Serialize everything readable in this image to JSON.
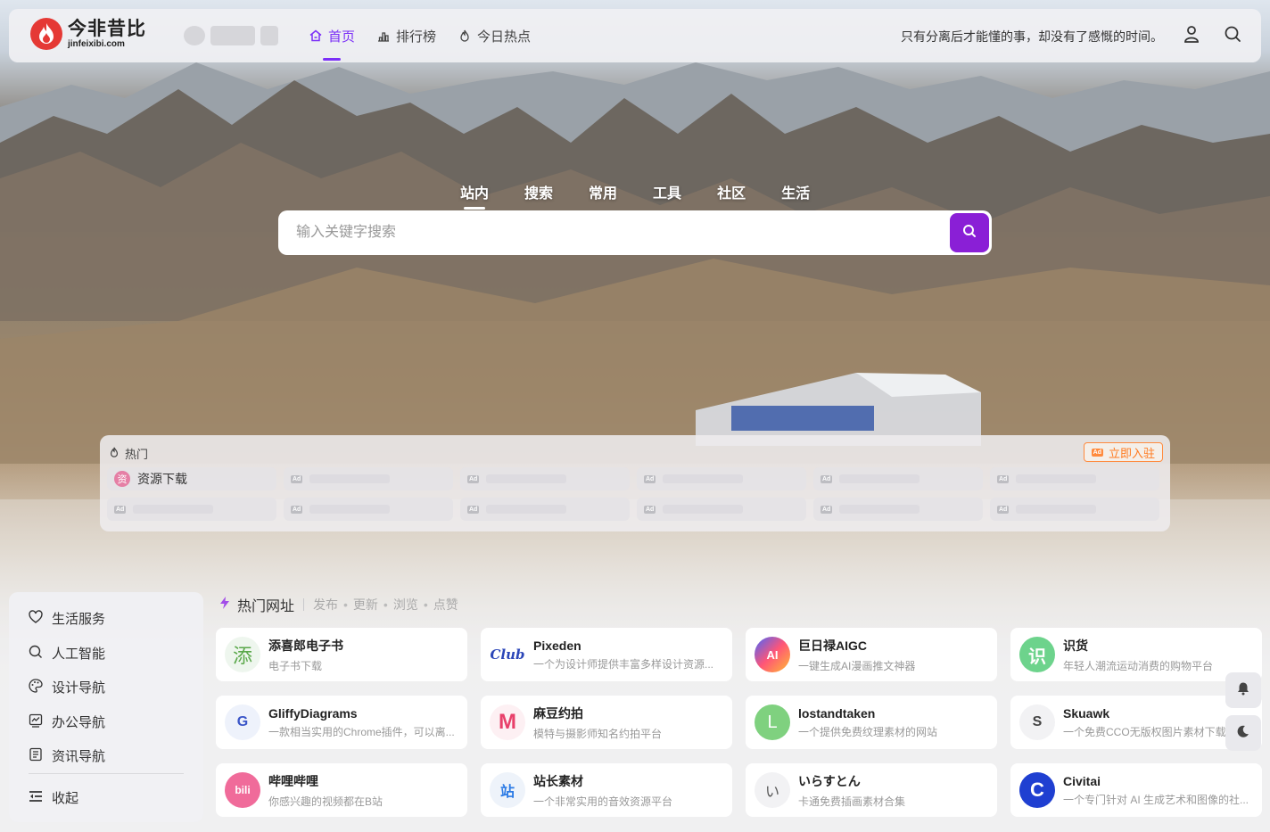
{
  "site": {
    "logo_cn": "今非昔比",
    "logo_en": "jinfeixibi.com",
    "slogan": "只有分离后才能懂的事，却没有了感慨的时间。"
  },
  "nav": {
    "items": [
      {
        "label": "首页",
        "icon": "home-icon",
        "active": true
      },
      {
        "label": "排行榜",
        "icon": "ranking-icon",
        "active": false
      },
      {
        "label": "今日热点",
        "icon": "fire-icon",
        "active": false
      }
    ]
  },
  "search": {
    "tabs": [
      "站内",
      "搜索",
      "常用",
      "工具",
      "社区",
      "生活"
    ],
    "active_tab": "站内",
    "placeholder": "输入关键字搜索"
  },
  "hot": {
    "title": "热门",
    "join_label": "立即入驻",
    "first_item": {
      "badge": "资",
      "label": "资源下载"
    }
  },
  "sidebar": {
    "items": [
      {
        "label": "生活服务",
        "icon": "heart-icon"
      },
      {
        "label": "人工智能",
        "icon": "search-icon"
      },
      {
        "label": "设计导航",
        "icon": "palette-icon"
      },
      {
        "label": "办公导航",
        "icon": "chart-box-icon"
      },
      {
        "label": "资讯导航",
        "icon": "document-icon"
      }
    ],
    "collapse_label": "收起"
  },
  "sites": {
    "title": "热门网址",
    "filters": [
      "发布",
      "更新",
      "浏览",
      "点赞"
    ],
    "cards": [
      {
        "title": "添喜郎电子书",
        "desc": "电子书下载",
        "icon_text": "添"
      },
      {
        "title": "Pixeden",
        "desc": "一个为设计师提供丰富多样设计资源...",
        "icon_text": "Club"
      },
      {
        "title": "巨日禄AIGC",
        "desc": "一键生成AI漫画推文神器",
        "icon_text": "AI"
      },
      {
        "title": "识货",
        "desc": "年轻人潮流运动消费的购物平台",
        "icon_text": "识"
      },
      {
        "title": "GliffyDiagrams",
        "desc": "一款相当实用的Chrome插件，可以离...",
        "icon_text": "G"
      },
      {
        "title": "麻豆约拍",
        "desc": "模特与摄影师知名约拍平台",
        "icon_text": "M"
      },
      {
        "title": "lostandtaken",
        "desc": "一个提供免费纹理素材的网站",
        "icon_text": "L"
      },
      {
        "title": "Skuawk",
        "desc": "一个免费CCO无版权图片素材下载",
        "icon_text": "S"
      },
      {
        "title": "哔哩哔哩",
        "desc": "你感兴趣的视频都在B站",
        "icon_text": "bili"
      },
      {
        "title": "站长素材",
        "desc": "一个非常实用的音效资源平台",
        "icon_text": "站"
      },
      {
        "title": "いらすとん",
        "desc": "卡通免费插画素材合集",
        "icon_text": "い"
      },
      {
        "title": "Civitai",
        "desc": "一个专门针对 AI 生成艺术和图像的社...",
        "icon_text": "C"
      }
    ]
  }
}
